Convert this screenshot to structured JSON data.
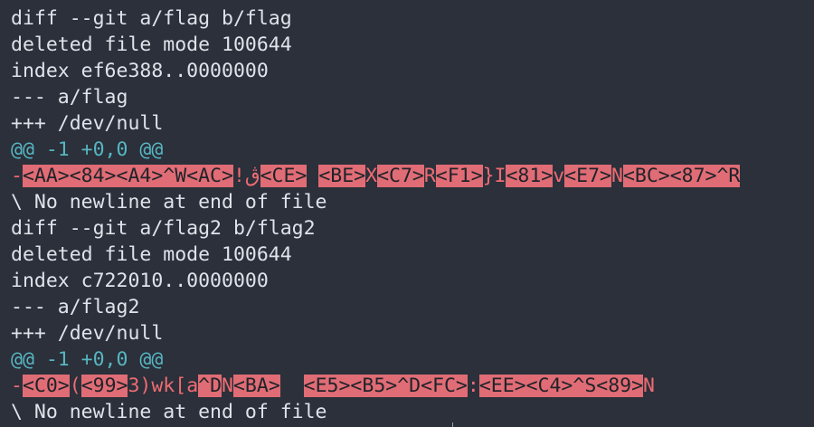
{
  "lines": [
    {
      "kind": "header",
      "text": "diff --git a/flag b/flag"
    },
    {
      "kind": "header",
      "text": "deleted file mode 100644"
    },
    {
      "kind": "header",
      "text": "index ef6e388..0000000"
    },
    {
      "kind": "header",
      "text": "--- a/flag"
    },
    {
      "kind": "header",
      "text": "+++ /dev/null"
    },
    {
      "kind": "hunk",
      "text": "@@ -1 +0,0 @@"
    },
    {
      "kind": "removed",
      "segments": [
        {
          "t": "-",
          "h": false
        },
        {
          "t": "<AA><84><A4>^W<AC>",
          "h": true
        },
        {
          "t": "!ڨ",
          "h": false
        },
        {
          "t": "<CE>",
          "h": true
        },
        {
          "t": " ",
          "h": false
        },
        {
          "t": "<BE>",
          "h": true
        },
        {
          "t": "X",
          "h": false
        },
        {
          "t": "<C7>",
          "h": true
        },
        {
          "t": "R",
          "h": false
        },
        {
          "t": "<F1>",
          "h": true
        },
        {
          "t": "}I",
          "h": false
        },
        {
          "t": "<81>",
          "h": true
        },
        {
          "t": "v",
          "h": false
        },
        {
          "t": "<E7>",
          "h": true
        },
        {
          "t": "N",
          "h": false
        },
        {
          "t": "<BC><87>^R",
          "h": true
        }
      ]
    },
    {
      "kind": "header",
      "text": "\\ No newline at end of file"
    },
    {
      "kind": "header",
      "text": "diff --git a/flag2 b/flag2"
    },
    {
      "kind": "header",
      "text": "deleted file mode 100644"
    },
    {
      "kind": "header",
      "text": "index c722010..0000000"
    },
    {
      "kind": "header",
      "text": "--- a/flag2"
    },
    {
      "kind": "header",
      "text": "+++ /dev/null"
    },
    {
      "kind": "hunk",
      "text": "@@ -1 +0,0 @@"
    },
    {
      "kind": "removed",
      "segments": [
        {
          "t": "-",
          "h": false
        },
        {
          "t": "<C0>",
          "h": true
        },
        {
          "t": "(",
          "h": false
        },
        {
          "t": "<99>",
          "h": true
        },
        {
          "t": "3)wk[a",
          "h": false
        },
        {
          "t": "^D",
          "h": true
        },
        {
          "t": "N",
          "h": false
        },
        {
          "t": "<BA>",
          "h": true
        },
        {
          "t": "  ",
          "h": false
        },
        {
          "t": "<E5><B5>^D<FC>",
          "h": true
        },
        {
          "t": ":",
          "h": false
        },
        {
          "t": "<EE><C4>^S<89>",
          "h": true
        },
        {
          "t": "N",
          "h": false
        }
      ]
    },
    {
      "kind": "header",
      "text": "\\ No newline at end of file"
    }
  ],
  "colors": {
    "background": "#2b303a",
    "text": "#dfe3ea",
    "hunk": "#56b6c2",
    "removed": "#ef6b73",
    "highlight_bg": "#e06c75"
  }
}
